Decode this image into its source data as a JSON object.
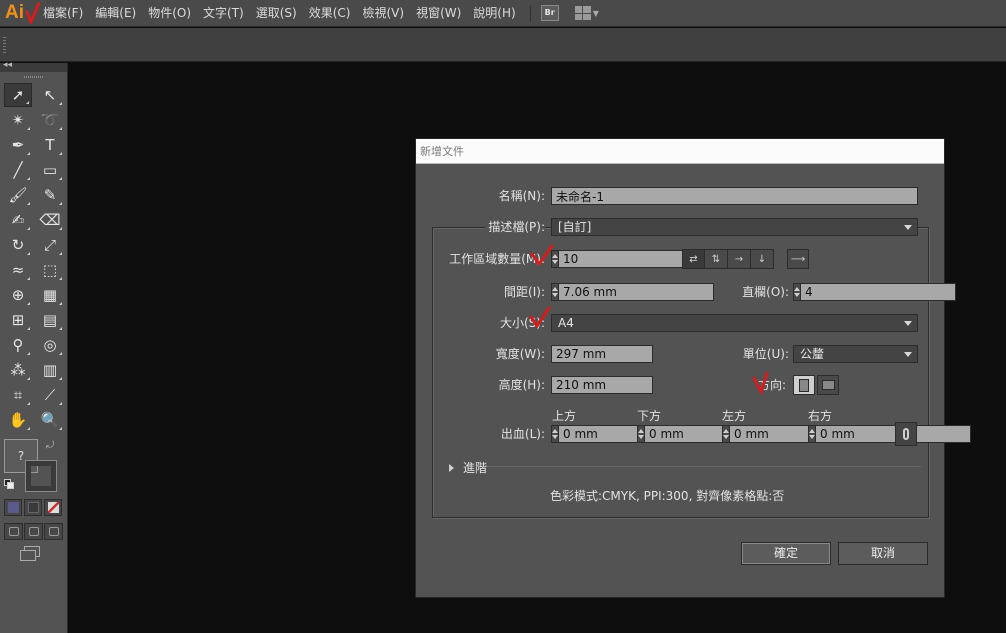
{
  "app": {
    "logo_text": "Ai",
    "menu": [
      "檔案(F)",
      "編輯(E)",
      "物件(O)",
      "文字(T)",
      "選取(S)",
      "效果(C)",
      "檢視(V)",
      "視窗(W)",
      "說明(H)"
    ],
    "bridge_label": "Br",
    "accent_color": "#f0921a",
    "annotation_color": "#d21e1e"
  },
  "tools": {
    "items": [
      {
        "name": "selection-tool-icon",
        "glyph": "➚"
      },
      {
        "name": "direct-selection-tool-icon",
        "glyph": "↖"
      },
      {
        "name": "magic-wand-tool-icon",
        "glyph": "✴"
      },
      {
        "name": "lasso-tool-icon",
        "glyph": "➰"
      },
      {
        "name": "pen-tool-icon",
        "glyph": "✒"
      },
      {
        "name": "type-tool-icon",
        "glyph": "T"
      },
      {
        "name": "line-segment-tool-icon",
        "glyph": "╱"
      },
      {
        "name": "rectangle-tool-icon",
        "glyph": "▭"
      },
      {
        "name": "paintbrush-tool-icon",
        "glyph": "🖌"
      },
      {
        "name": "pencil-tool-icon",
        "glyph": "✎"
      },
      {
        "name": "blob-brush-tool-icon",
        "glyph": "✍"
      },
      {
        "name": "eraser-tool-icon",
        "glyph": "⌫"
      },
      {
        "name": "rotate-tool-icon",
        "glyph": "↻"
      },
      {
        "name": "scale-tool-icon",
        "glyph": "⤢"
      },
      {
        "name": "warp-tool-icon",
        "glyph": "≈"
      },
      {
        "name": "free-transform-tool-icon",
        "glyph": "⬚"
      },
      {
        "name": "shape-builder-tool-icon",
        "glyph": "⊕"
      },
      {
        "name": "perspective-grid-tool-icon",
        "glyph": "▦"
      },
      {
        "name": "mesh-tool-icon",
        "glyph": "⊞"
      },
      {
        "name": "gradient-tool-icon",
        "glyph": "▤"
      },
      {
        "name": "eyedropper-tool-icon",
        "glyph": "⚲"
      },
      {
        "name": "blend-tool-icon",
        "glyph": "◎"
      },
      {
        "name": "symbol-sprayer-tool-icon",
        "glyph": "⁂"
      },
      {
        "name": "column-graph-tool-icon",
        "glyph": "▥"
      },
      {
        "name": "artboard-tool-icon",
        "glyph": "⌗"
      },
      {
        "name": "slice-tool-icon",
        "glyph": "⟋"
      },
      {
        "name": "hand-tool-icon",
        "glyph": "✋"
      },
      {
        "name": "zoom-tool-icon",
        "glyph": "🔍"
      }
    ],
    "fill_label": "?"
  },
  "dialog": {
    "title": "新增文件",
    "name_label": "名稱(N):",
    "name_value": "未命名-1",
    "profile_label": "描述檔(P):",
    "profile_value": "[自訂]",
    "artboards_label": "工作區域數量(M):",
    "artboards_value": "10",
    "spacing_label": "間距(I):",
    "spacing_value": "7.06 mm",
    "columns_label": "直欄(O):",
    "columns_value": "4",
    "size_label": "大小(S):",
    "size_value": "A4",
    "width_label": "寬度(W):",
    "width_value": "297 mm",
    "units_label": "單位(U):",
    "units_value": "公釐",
    "height_label": "高度(H):",
    "height_value": "210 mm",
    "orientation_label": "方向:",
    "bleed_label": "出血(L):",
    "bleed_top_label": "上方",
    "bleed_bottom_label": "下方",
    "bleed_left_label": "左方",
    "bleed_right_label": "右方",
    "bleed_top": "0 mm",
    "bleed_bottom": "0 mm",
    "bleed_left": "0 mm",
    "bleed_right": "0 mm",
    "advanced_label": "進階",
    "summary": "色彩模式:CMYK, PPI:300, 對齊像素格點:否",
    "ok_label": "確定",
    "cancel_label": "取消"
  }
}
